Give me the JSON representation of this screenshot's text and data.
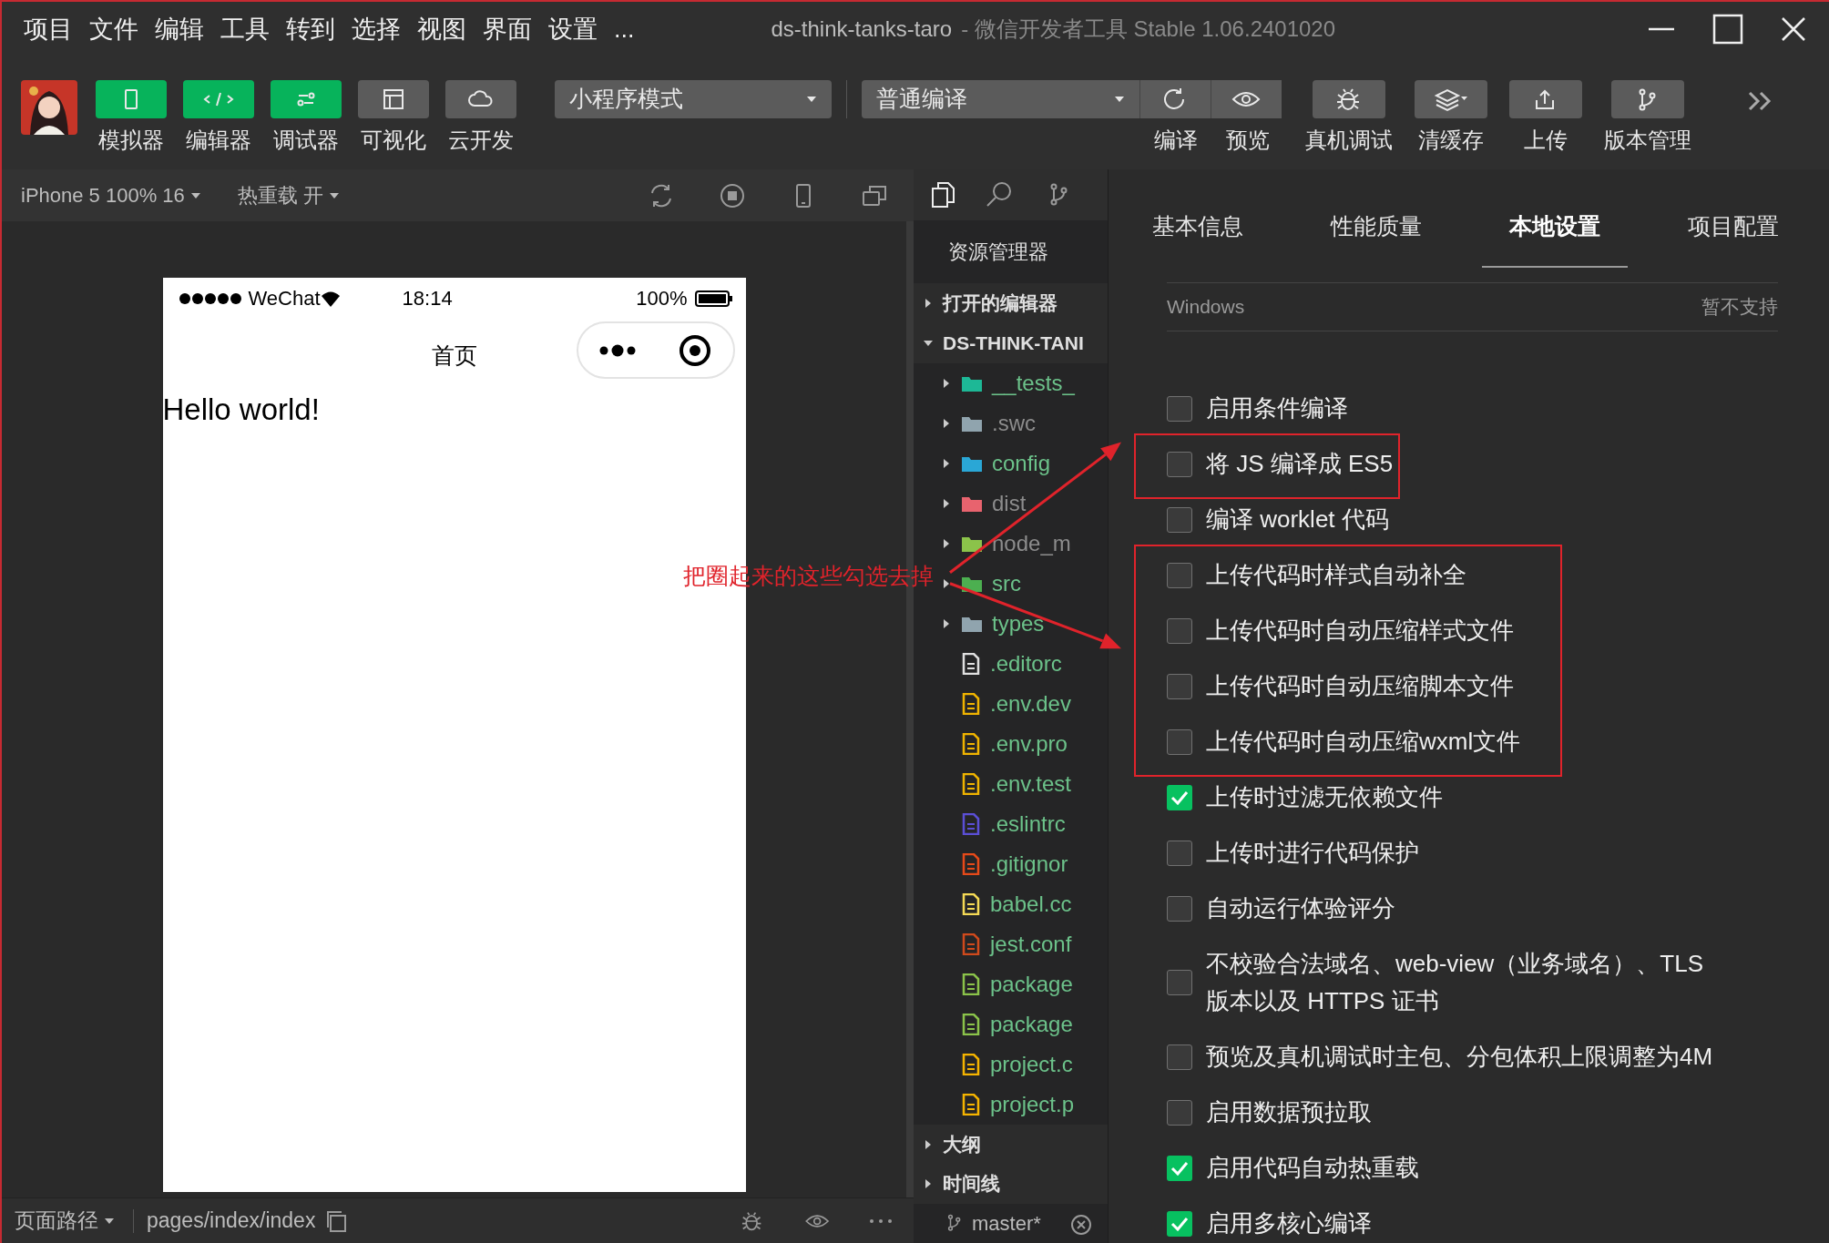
{
  "window": {
    "title": "ds-think-tanks-taro",
    "subtitle": "- 微信开发者工具 Stable 1.06.2401020"
  },
  "menu": [
    "项目",
    "文件",
    "编辑",
    "工具",
    "转到",
    "选择",
    "视图",
    "界面",
    "设置",
    "..."
  ],
  "toolbar": {
    "view_buttons": [
      {
        "label": "模拟器",
        "on": true
      },
      {
        "label": "编辑器",
        "on": true
      },
      {
        "label": "调试器",
        "on": true
      },
      {
        "label": "可视化",
        "on": false
      },
      {
        "label": "云开发",
        "on": false
      }
    ],
    "mode_select": "小程序模式",
    "compile_select": "普通编译",
    "actions": [
      {
        "label": "编译",
        "kind": "joined"
      },
      {
        "label": "预览",
        "kind": "joined"
      },
      {
        "label": "真机调试",
        "kind": "button"
      },
      {
        "label": "清缓存",
        "kind": "dropdown"
      },
      {
        "label": "上传",
        "kind": "button"
      },
      {
        "label": "版本管理",
        "kind": "button"
      }
    ]
  },
  "simulator": {
    "device": "iPhone 5 100% 16",
    "hot_reload": "热重载 开",
    "phone": {
      "carrier": "WeChat",
      "time": "18:14",
      "battery": "100%",
      "nav_title": "首页",
      "content": "Hello world!"
    }
  },
  "status_bar": {
    "page_path_label": "页面路径",
    "page_path": "pages/index/index"
  },
  "explorer": {
    "title": "资源管理器",
    "sections": [
      {
        "label": "打开的编辑器",
        "expanded": false
      },
      {
        "label": "DS-THINK-TANI",
        "expanded": true,
        "children": [
          {
            "name": "__tests_",
            "kind": "folder",
            "ignored": false,
            "color": "#1db896"
          },
          {
            "name": ".swc",
            "kind": "folder",
            "ignored": true,
            "color": "#90a4ae"
          },
          {
            "name": "config",
            "kind": "folder",
            "ignored": false,
            "color": "#2aa7d6"
          },
          {
            "name": "dist",
            "kind": "folder",
            "ignored": true,
            "color": "#e8636e"
          },
          {
            "name": "node_m",
            "kind": "folder",
            "ignored": true,
            "color": "#8bc34a"
          },
          {
            "name": "src",
            "kind": "folder",
            "ignored": false,
            "color": "#4caf50"
          },
          {
            "name": "types",
            "kind": "folder",
            "ignored": false,
            "color": "#90a4ae"
          },
          {
            "name": ".editorc",
            "kind": "file",
            "ignored": false,
            "color": "#e0e0e0"
          },
          {
            "name": ".env.dev",
            "kind": "file",
            "ignored": false,
            "color": "#f0b400"
          },
          {
            "name": ".env.pro",
            "kind": "file",
            "ignored": false,
            "color": "#f0b400"
          },
          {
            "name": ".env.test",
            "kind": "file",
            "ignored": false,
            "color": "#f0b400"
          },
          {
            "name": ".eslintrc",
            "kind": "file",
            "ignored": false,
            "color": "#5b4fd6"
          },
          {
            "name": ".gitignor",
            "kind": "file",
            "ignored": false,
            "color": "#e64a19"
          },
          {
            "name": "babel.cc",
            "kind": "file",
            "ignored": false,
            "color": "#f5da55"
          },
          {
            "name": "jest.conf",
            "kind": "file",
            "ignored": false,
            "color": "#d04a1c"
          },
          {
            "name": "package",
            "kind": "file",
            "ignored": false,
            "color": "#8bc34a"
          },
          {
            "name": "package",
            "kind": "file",
            "ignored": false,
            "color": "#8bc34a"
          },
          {
            "name": "project.c",
            "kind": "file",
            "ignored": false,
            "color": "#f5b400"
          },
          {
            "name": "project.p",
            "kind": "file",
            "ignored": false,
            "color": "#f5b400"
          }
        ]
      },
      {
        "label": "大纲",
        "expanded": false
      },
      {
        "label": "时间线",
        "expanded": false
      }
    ],
    "branch": "master*"
  },
  "settings": {
    "tabs": [
      {
        "label": "基本信息",
        "selected": false
      },
      {
        "label": "性能质量",
        "selected": false
      },
      {
        "label": "本地设置",
        "selected": true
      },
      {
        "label": "项目配置",
        "selected": false
      }
    ],
    "platform_row": {
      "label": "Windows",
      "value": "暂不支持"
    },
    "options": [
      {
        "label": "启用条件编译",
        "checked": false,
        "highlighted": false
      },
      {
        "label": "将 JS 编译成 ES5",
        "checked": false,
        "highlighted": true
      },
      {
        "label": "编译 worklet 代码",
        "checked": false,
        "highlighted": false
      },
      {
        "label": "上传代码时样式自动补全",
        "checked": false,
        "highlighted": true
      },
      {
        "label": "上传代码时自动压缩样式文件",
        "checked": false,
        "highlighted": true
      },
      {
        "label": "上传代码时自动压缩脚本文件",
        "checked": false,
        "highlighted": true
      },
      {
        "label": "上传代码时自动压缩wxml文件",
        "checked": false,
        "highlighted": true
      },
      {
        "label": "上传时过滤无依赖文件",
        "checked": true,
        "highlighted": false
      },
      {
        "label": "上传时进行代码保护",
        "checked": false,
        "highlighted": false
      },
      {
        "label": "自动运行体验评分",
        "checked": false,
        "highlighted": false
      },
      {
        "label": "不校验合法域名、web-view（业务域名）、TLS\n版本以及 HTTPS 证书",
        "checked": false,
        "highlighted": false
      },
      {
        "label": "预览及真机调试时主包、分包体积上限调整为4M",
        "checked": false,
        "highlighted": false
      },
      {
        "label": "启用数据预拉取",
        "checked": false,
        "highlighted": false
      },
      {
        "label": "启用代码自动热重载",
        "checked": true,
        "highlighted": false
      },
      {
        "label": "启用多核心编译",
        "checked": true,
        "highlighted": false
      }
    ]
  },
  "annotation": {
    "text": "把圈起来的这些勾选去掉"
  }
}
